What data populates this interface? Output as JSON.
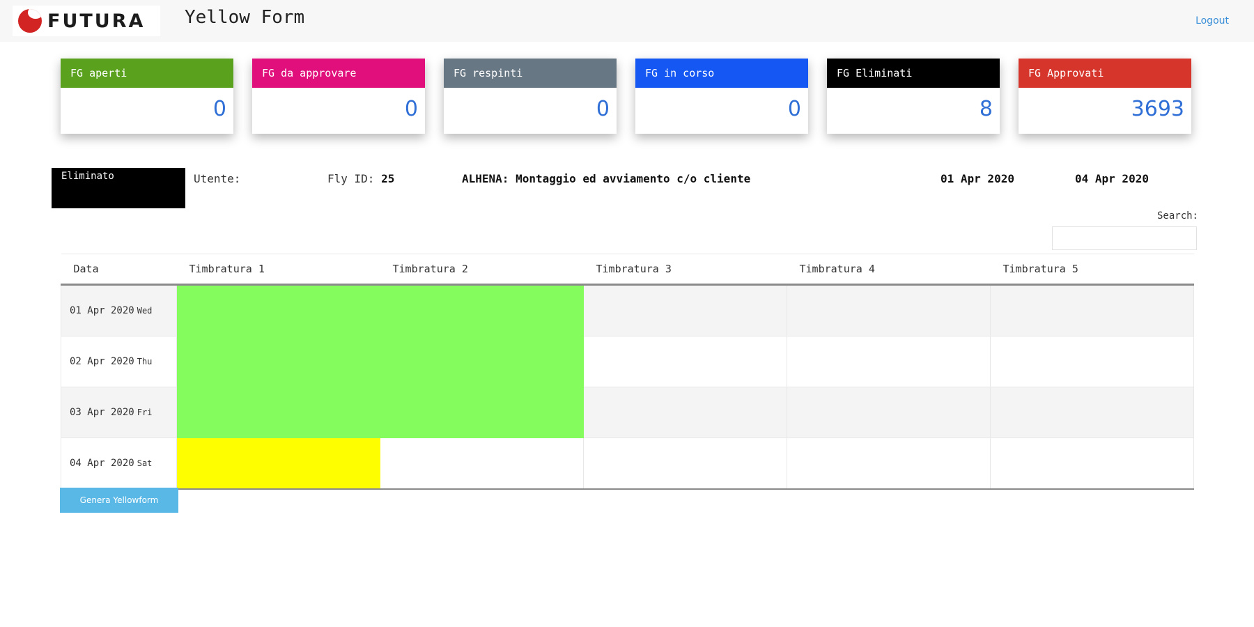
{
  "header": {
    "logo_text": "FUTURA",
    "title": "Yellow Form",
    "logout_label": "Logout"
  },
  "cards": [
    {
      "label": "FG aperti",
      "value": "0",
      "color": "#5aa21e"
    },
    {
      "label": "FG da approvare",
      "value": "0",
      "color": "#e00f7c"
    },
    {
      "label": "FG respinti",
      "value": "0",
      "color": "#687784"
    },
    {
      "label": "FG in corso",
      "value": "0",
      "color": "#1457f2"
    },
    {
      "label": "FG Eliminati",
      "value": "8",
      "color": "#000000"
    },
    {
      "label": "FG Approvati",
      "value": "3693",
      "color": "#d6352b"
    }
  ],
  "info": {
    "status": "Eliminato",
    "user_label": "Utente:",
    "user_value": "",
    "fly_label": "Fly ID:",
    "fly_value": "25",
    "project": "ALHENA: Montaggio ed avviamento c/o cliente",
    "date_from": "01 Apr 2020",
    "date_to": "04 Apr 2020"
  },
  "search": {
    "label": "Search:",
    "value": ""
  },
  "table": {
    "headers": [
      "Data",
      "Timbratura 1",
      "Timbratura 2",
      "Timbratura 3",
      "Timbratura 4",
      "Timbratura 5"
    ],
    "rows": [
      {
        "date": "01 Apr 2020",
        "weekday": "Wed"
      },
      {
        "date": "02 Apr 2020",
        "weekday": "Thu"
      },
      {
        "date": "03 Apr 2020",
        "weekday": "Fri"
      },
      {
        "date": "04 Apr 2020",
        "weekday": "Sat"
      }
    ],
    "colors": {
      "green": "#84fc5e",
      "yellow": "#fffe00"
    }
  },
  "actions": {
    "generate_label": "Genera Yellowform"
  }
}
